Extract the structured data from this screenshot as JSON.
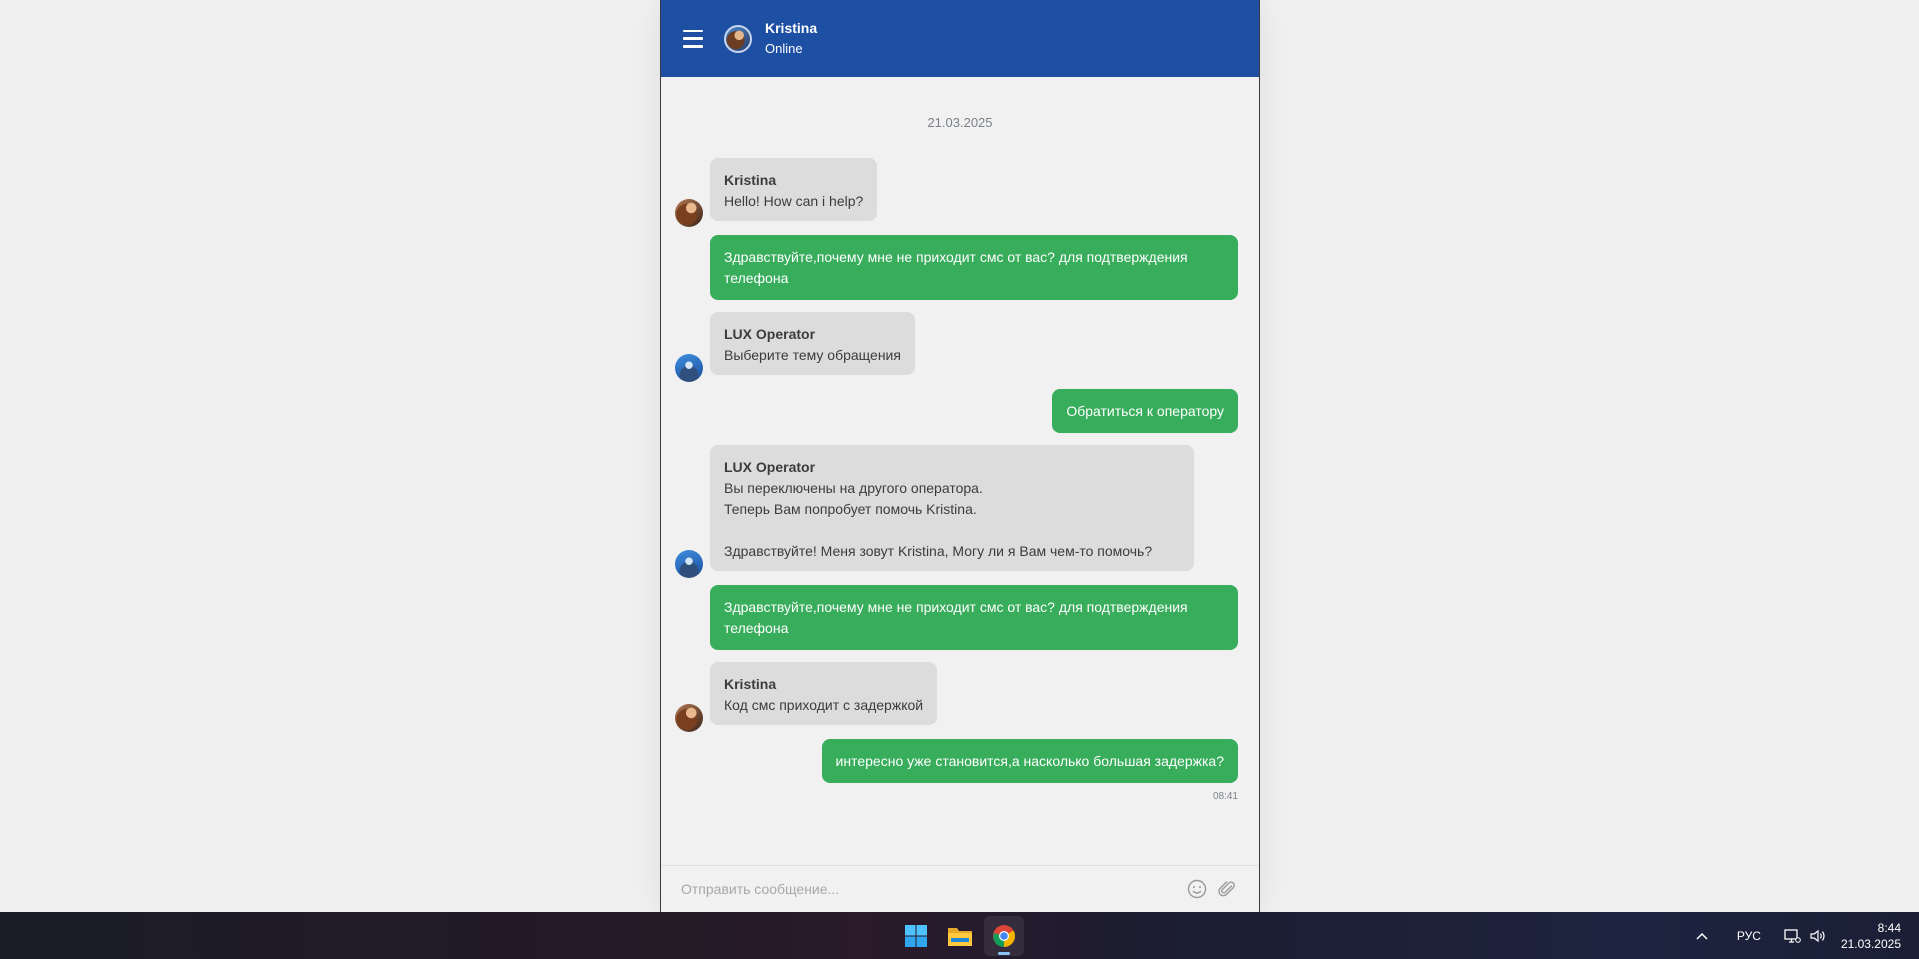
{
  "header": {
    "name": "Kristina",
    "status": "Online"
  },
  "date_separator": "21.03.2025",
  "messages": [
    {
      "author": "Kristina",
      "text": "Hello! How can i help?"
    },
    {
      "text": "Здравствуйте,почему мне не приходит смс от вас? для подтверждения телефона"
    },
    {
      "author": "LUX Operator",
      "text": "Выберите тему обращения"
    },
    {
      "text": "Обратиться к оператору"
    },
    {
      "author": "LUX Operator",
      "text": "Вы переключены на другого оператора.\nТеперь Вам попробует помочь Kristina.\n\nЗдравствуйте! Меня зовут Kristina, Могу ли я Вам чем-то помочь?"
    },
    {
      "text": "Здравствуйте,почему мне не приходит смс от вас? для подтверждения телефона"
    },
    {
      "author": "Kristina",
      "text": "Код смс приходит с задержкой"
    },
    {
      "text": "интересно уже становится,а насколько большая задержка?"
    }
  ],
  "last_message_time": "08:41",
  "composer": {
    "placeholder": "Отправить сообщение..."
  },
  "taskbar": {
    "apps": [
      "start-icon",
      "file-explorer-icon",
      "chrome-icon"
    ],
    "language": "РУС",
    "time": "8:44",
    "date": "21.03.2025"
  },
  "colors": {
    "header": "#1d4fa3",
    "outgoing": "#38ad5c",
    "incoming": "#dcdcdc"
  }
}
